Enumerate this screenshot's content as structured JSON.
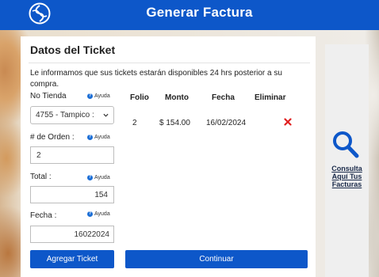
{
  "header": {
    "title": "Generar Factura",
    "logo_icon": "swirl-logo-icon"
  },
  "card": {
    "title": "Datos del Ticket",
    "info": "Le informamos que sus tickets estarán disponibles 24 hrs posterior a su compra.",
    "help_label": "Ayuda",
    "store": {
      "label": "No Tienda",
      "value": "4755 - Tampico :"
    },
    "order": {
      "label": "# de Orden :",
      "value": "2"
    },
    "total": {
      "label": "Total :",
      "value": "154"
    },
    "date": {
      "label": "Fecha :",
      "value": "16022024"
    },
    "add_button": "Agregar Ticket",
    "continue_button": "Continuar",
    "table": {
      "headers": [
        "Folio",
        "Monto",
        "Fecha",
        "Eliminar"
      ],
      "rows": [
        {
          "folio": "2",
          "monto": "$ 154.00",
          "fecha": "16/02/2024",
          "delete_icon": "red-x-icon"
        }
      ]
    }
  },
  "side": {
    "link_lines": [
      "Consulta",
      "Aquí Tus",
      "Facturas"
    ],
    "icon": "search-icon"
  },
  "colors": {
    "primary": "#0d57c9",
    "delete": "#e02020",
    "search": "#0d57c9"
  }
}
